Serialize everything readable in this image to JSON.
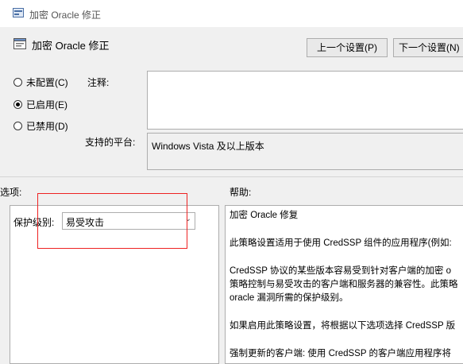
{
  "window": {
    "title": "加密 Oracle 修正"
  },
  "header": {
    "title": "加密 Oracle 修正"
  },
  "buttons": {
    "prev": "上一个设置(P)",
    "next": "下一个设置(N)"
  },
  "state": {
    "options": [
      {
        "label": "未配置(C)",
        "selected": false
      },
      {
        "label": "已启用(E)",
        "selected": true
      },
      {
        "label": "已禁用(D)",
        "selected": false
      }
    ]
  },
  "comment": {
    "label": "注释:",
    "value": ""
  },
  "platform": {
    "label": "支持的平台:",
    "value": "Windows Vista 及以上版本"
  },
  "options_section": {
    "title": "选项:",
    "protection_label": "保护级别:",
    "protection_value": "易受攻击"
  },
  "help_section": {
    "title": "帮助:",
    "paragraphs": [
      "加密 Oracle 修复",
      "此策略设置适用于使用 CredSSP 组件的应用程序(例如:",
      "CredSSP 协议的某些版本容易受到针对客户端的加密 o",
      "策略控制与易受攻击的客户端和服务器的兼容性。此策略",
      "oracle 漏洞所需的保护级别。",
      "如果启用此策略设置，将根据以下选项选择 CredSSP 版",
      "强制更新的客户端: 使用 CredSSP 的客户端应用程序将"
    ]
  }
}
